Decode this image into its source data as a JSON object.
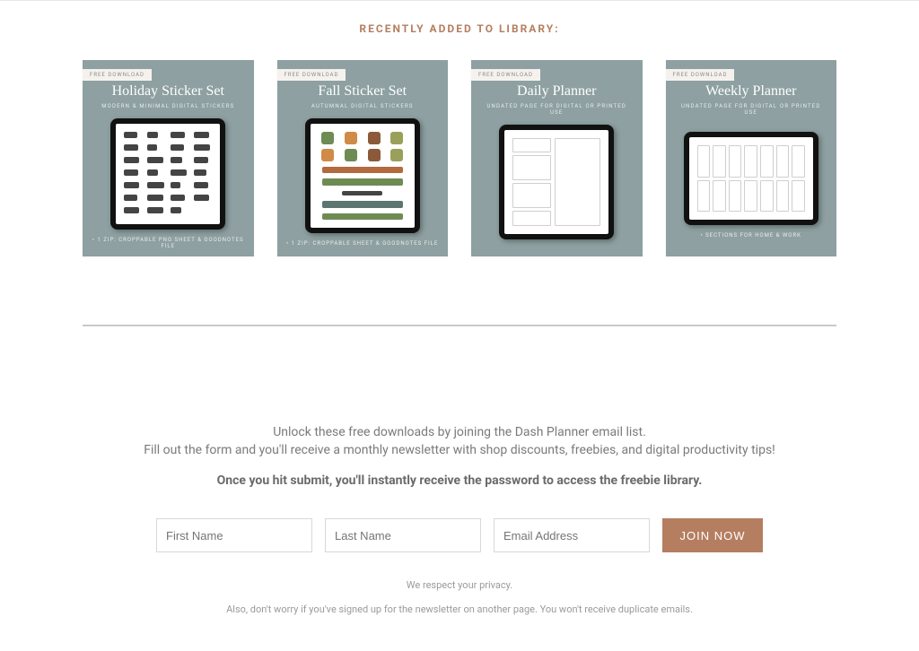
{
  "section_title": "RECENTLY ADDED TO LIBRARY:",
  "cards": [
    {
      "badge": "FREE DOWNLOAD",
      "title": "Holiday Sticker Set",
      "subtitle": "MODERN & MINIMAL DIGITAL STICKERS",
      "footer": "• 1 ZIP: CROPPABLE PNG SHEET & GOODNOTES FILE",
      "type": "script"
    },
    {
      "badge": "FREE DOWNLOAD",
      "title": "Fall Sticker Set",
      "subtitle": "AUTUMNAL DIGITAL STICKERS",
      "footer": "• 1 ZIP: CROPPABLE SHEET & GOODNOTES FILE",
      "type": "fall"
    },
    {
      "badge": "FREE DOWNLOAD",
      "title": "Daily Planner",
      "subtitle": "UNDATED PAGE FOR DIGITAL OR PRINTED USE",
      "footer": "",
      "type": "daily"
    },
    {
      "badge": "FREE DOWNLOAD",
      "title": "Weekly Planner",
      "subtitle": "UNDATED PAGE FOR DIGITAL OR PRINTED USE",
      "footer": "• SECTIONS FOR HOME & WORK",
      "type": "weekly"
    }
  ],
  "cta": {
    "line1": "Unlock these free downloads by joining the Dash Planner email list.",
    "line2": "Fill out the form and you'll receive a monthly newsletter with shop discounts, freebies, and digital productivity tips!",
    "strong": "Once you hit submit, you'll instantly receive the password to access the freebie library."
  },
  "form": {
    "first_name_placeholder": "First Name",
    "last_name_placeholder": "Last Name",
    "email_placeholder": "Email Address",
    "submit_label": "JOIN NOW"
  },
  "notes": {
    "privacy": "We respect your privacy.",
    "duplicate": "Also, don't worry if you've signed up for the newsletter on another page. You won't receive duplicate emails."
  }
}
